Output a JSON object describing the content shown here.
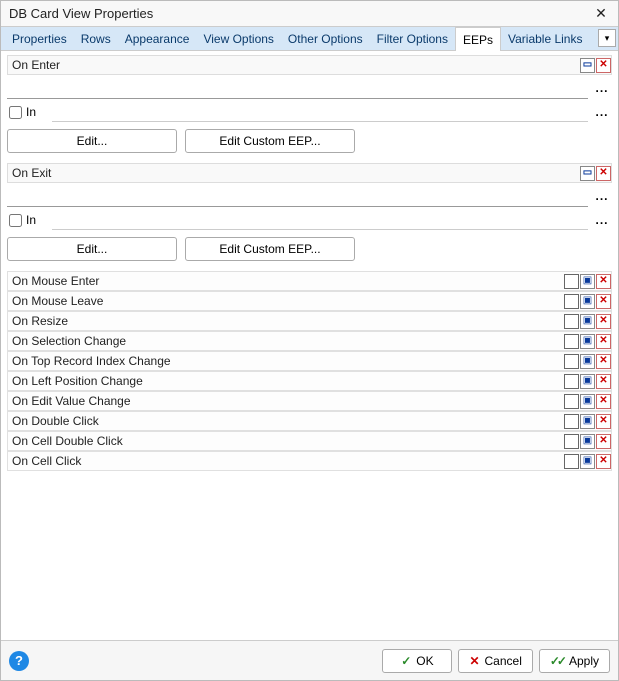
{
  "window": {
    "title": "DB Card View Properties"
  },
  "tabs": [
    {
      "label": "Properties"
    },
    {
      "label": "Rows"
    },
    {
      "label": "Appearance"
    },
    {
      "label": "View Options"
    },
    {
      "label": "Other Options"
    },
    {
      "label": "Filter Options"
    },
    {
      "label": "EEPs"
    },
    {
      "label": "Variable Links"
    }
  ],
  "active_tab": "EEPs",
  "sections": {
    "on_enter": {
      "label": "On Enter",
      "value": "",
      "in_checked": false,
      "in_label": "In",
      "in_value": "",
      "edit_label": "Edit...",
      "edit_custom_label": "Edit Custom EEP..."
    },
    "on_exit": {
      "label": "On Exit",
      "value": "",
      "in_checked": false,
      "in_label": "In",
      "in_value": "",
      "edit_label": "Edit...",
      "edit_custom_label": "Edit Custom EEP..."
    }
  },
  "events": [
    {
      "label": "On Mouse Enter"
    },
    {
      "label": "On Mouse Leave"
    },
    {
      "label": "On Resize"
    },
    {
      "label": "On Selection Change"
    },
    {
      "label": "On Top Record Index Change"
    },
    {
      "label": "On Left Position Change"
    },
    {
      "label": "On Edit Value Change"
    },
    {
      "label": "On Double Click"
    },
    {
      "label": "On Cell Double Click"
    },
    {
      "label": "On Cell Click"
    }
  ],
  "footer": {
    "ok": "OK",
    "cancel": "Cancel",
    "apply": "Apply"
  },
  "glyphs": {
    "ellipsis": "...",
    "close": "✕",
    "dropdown": "▾",
    "minus": "▭",
    "x": "✕",
    "sq": "▣",
    "empty": "",
    "help": "?",
    "check": "✓",
    "dblcheck": "✓✓"
  }
}
